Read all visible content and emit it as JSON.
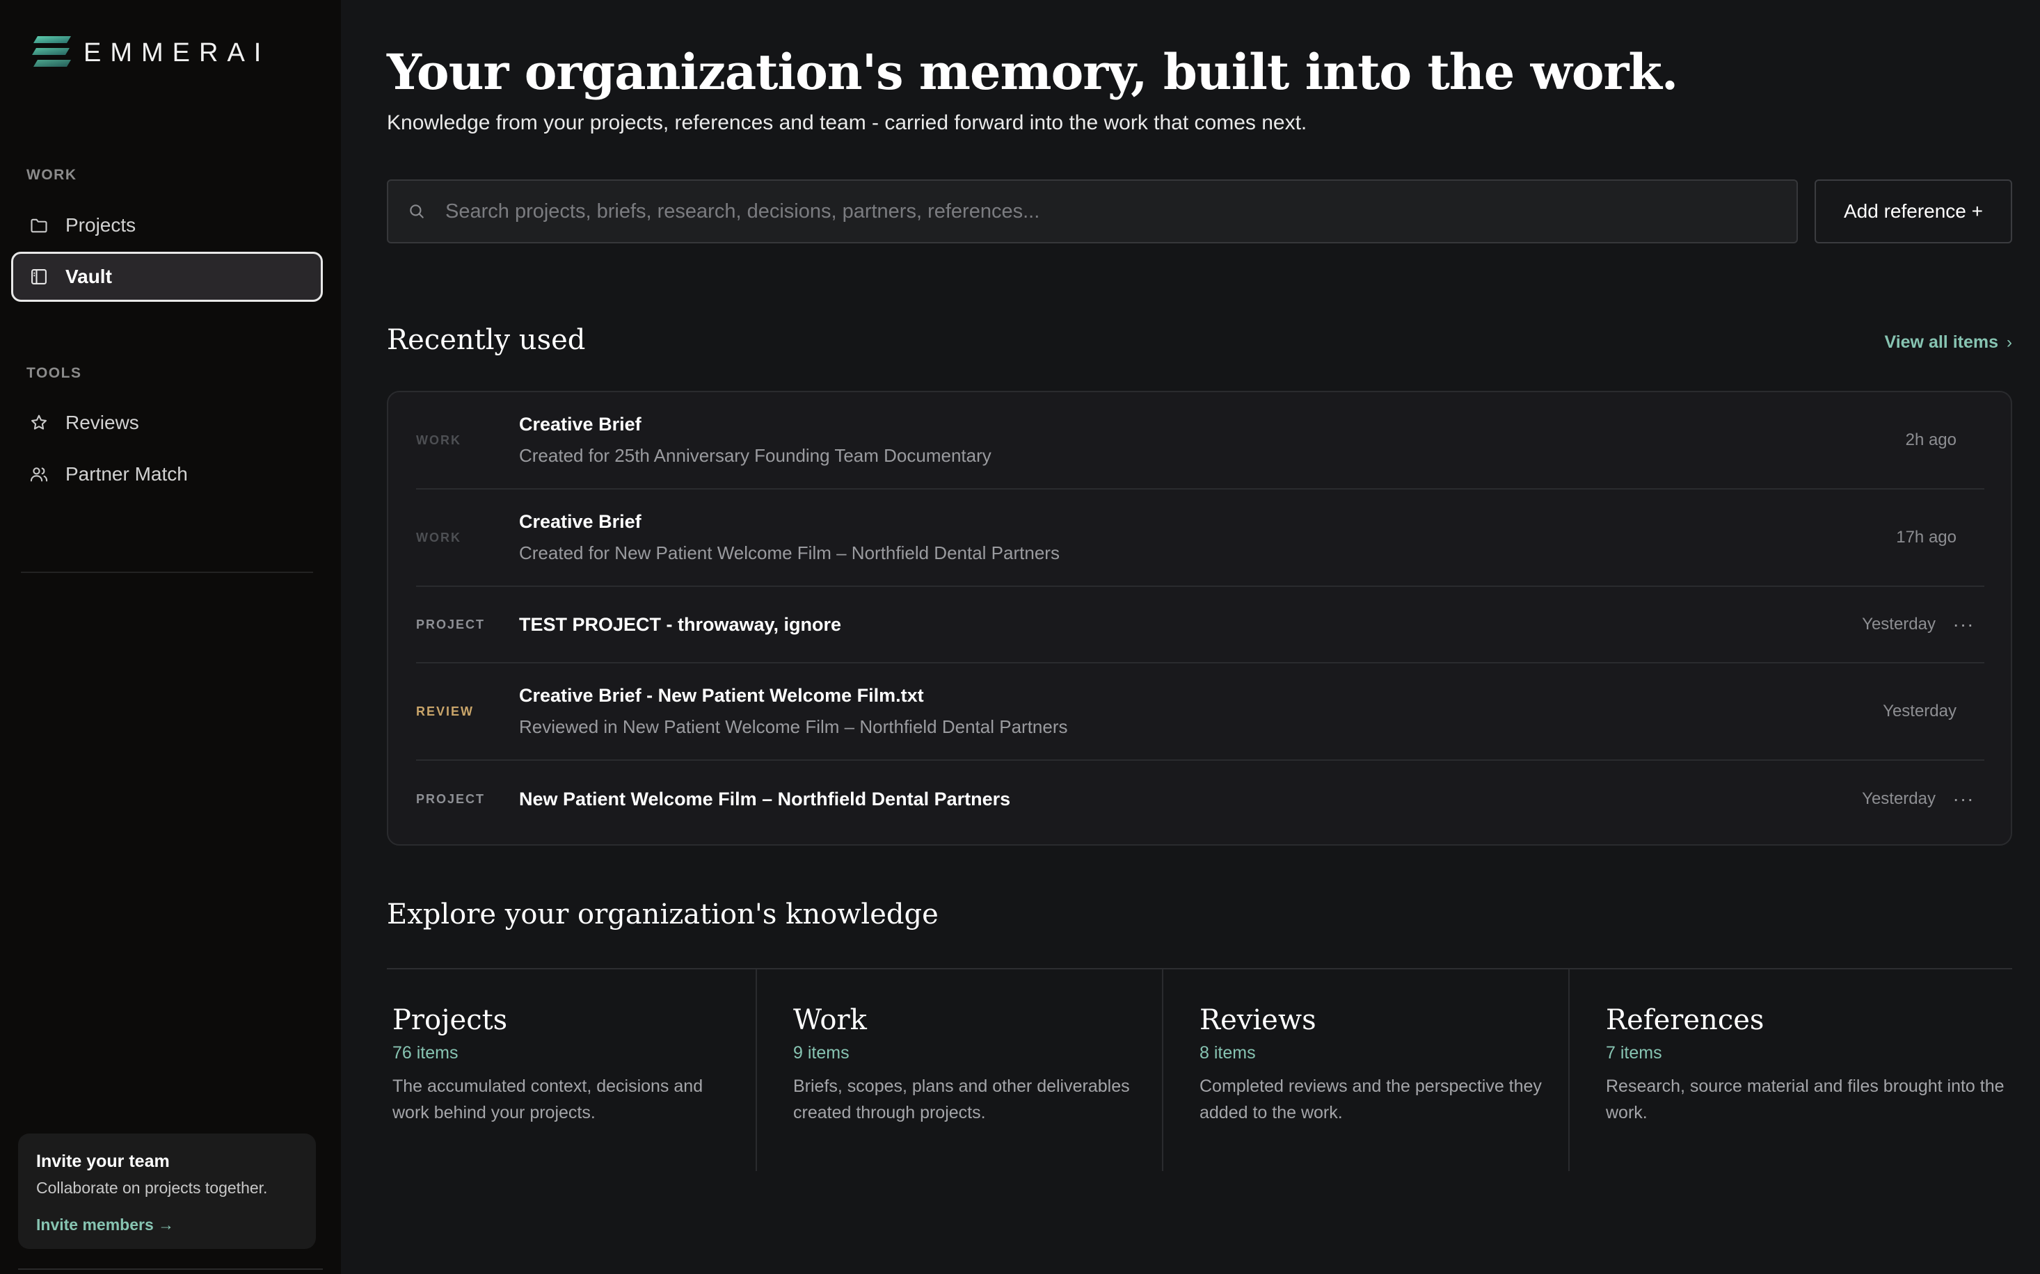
{
  "brand": {
    "name": "EMMERAI"
  },
  "sidebar": {
    "sections": [
      {
        "label": "WORK",
        "items": [
          {
            "label": "Projects",
            "icon": "folder-icon",
            "active": false
          },
          {
            "label": "Vault",
            "icon": "sidebar-panel-icon",
            "active": true
          }
        ]
      },
      {
        "label": "TOOLS",
        "items": [
          {
            "label": "Reviews",
            "icon": "star-icon",
            "active": false
          },
          {
            "label": "Partner Match",
            "icon": "users-icon",
            "active": false
          }
        ]
      }
    ],
    "invite": {
      "title": "Invite your team",
      "subtitle": "Collaborate on projects together.",
      "link": "Invite members →"
    }
  },
  "header": {
    "title": "Your organization's memory, built into the work.",
    "subtitle": "Knowledge from your projects, references and team - carried forward into the work that comes next."
  },
  "search": {
    "placeholder": "Search projects, briefs, research, decisions, partners, references...",
    "value": ""
  },
  "add_reference_label": "Add reference +",
  "recent": {
    "title": "Recently used",
    "view_all": "View all items",
    "items": [
      {
        "type": "WORK",
        "title": "Creative Brief",
        "subtitle": "Created for 25th Anniversary Founding Team Documentary",
        "time": "2h ago",
        "menu": false
      },
      {
        "type": "WORK",
        "title": "Creative Brief",
        "subtitle": "Created for New Patient Welcome Film – Northfield Dental Partners",
        "time": "17h ago",
        "menu": false
      },
      {
        "type": "PROJECT",
        "title": "TEST PROJECT - throwaway, ignore",
        "subtitle": "",
        "time": "Yesterday",
        "menu": true
      },
      {
        "type": "REVIEW",
        "title": "Creative Brief - New Patient Welcome Film.txt",
        "subtitle": "Reviewed in New Patient Welcome Film – Northfield Dental Partners",
        "time": "Yesterday",
        "menu": false
      },
      {
        "type": "PROJECT",
        "title": "New Patient Welcome Film – Northfield Dental Partners",
        "subtitle": "",
        "time": "Yesterday",
        "menu": true
      }
    ]
  },
  "explore": {
    "title": "Explore your organization's knowledge",
    "categories": [
      {
        "title": "Projects",
        "count": "76 items",
        "description": "The accumulated context, decisions and work behind your projects."
      },
      {
        "title": "Work",
        "count": "9 items",
        "description": "Briefs, scopes, plans and other deliverables created through projects."
      },
      {
        "title": "Reviews",
        "count": "8 items",
        "description": "Completed reviews and the perspective they added to the work."
      },
      {
        "title": "References",
        "count": "7 items",
        "description": "Research, source material and files brought into the work."
      }
    ]
  },
  "colors": {
    "accent": "#87c4b2",
    "review_tag": "#c9a56a",
    "sidebar_bg": "#0c0b0a",
    "main_bg": "#141517"
  }
}
